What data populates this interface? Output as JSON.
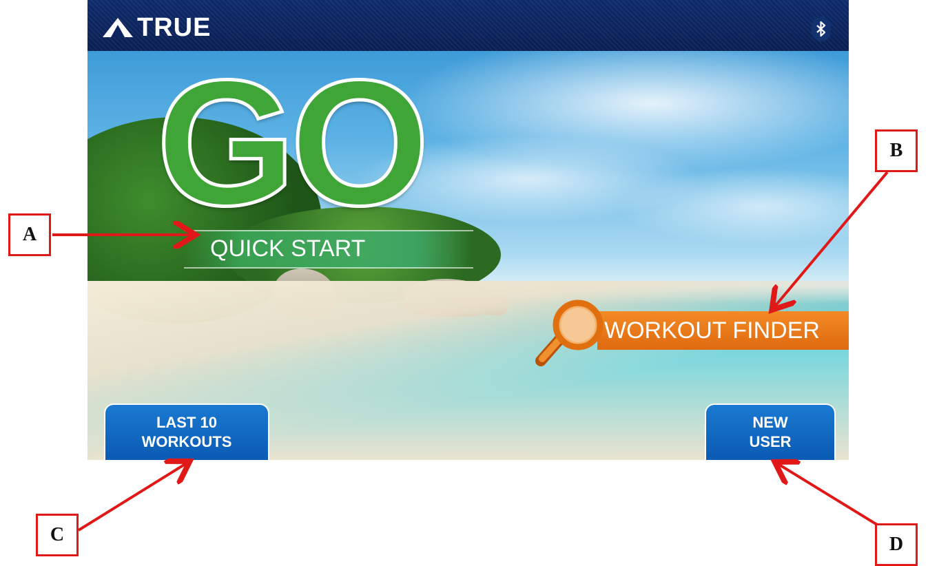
{
  "header": {
    "brand": "TRUE",
    "bluetooth_icon": "bluetooth-icon"
  },
  "main": {
    "go_label": "GO",
    "quick_start_label": "QUICK START",
    "workout_finder_label": "WORKOUT FINDER",
    "workout_finder_icon": "magnifier-icon"
  },
  "buttons": {
    "last10_line1": "LAST 10",
    "last10_line2": "WORKOUTS",
    "newuser_line1": "NEW",
    "newuser_line2": "USER"
  },
  "annotations": {
    "a": "A",
    "b": "B",
    "c": "C",
    "d": "D"
  },
  "colors": {
    "header_bg": "#0a1f52",
    "go_green": "#3ea536",
    "finder_orange": "#e06a10",
    "button_blue": "#0b5ab4",
    "callout_red": "#e11818"
  }
}
